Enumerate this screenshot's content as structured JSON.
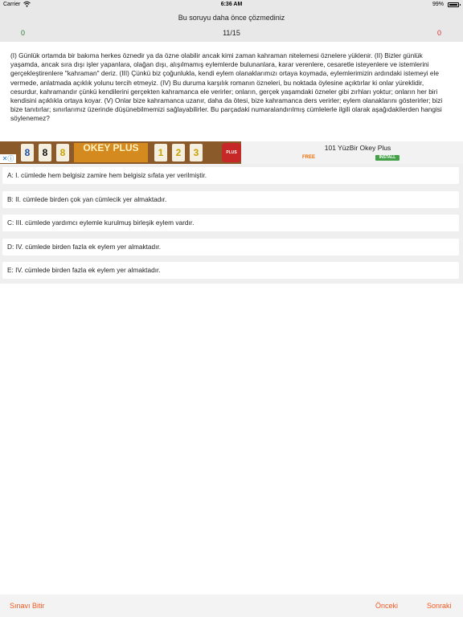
{
  "status_bar": {
    "carrier": "Carrier",
    "time": "6:36 AM",
    "battery": "99%"
  },
  "header": {
    "title": "Bu soruyu daha önce çözmediniz",
    "correct_count": "0",
    "progress": "11/15",
    "wrong_count": "0",
    "correct_color": "#2e7d32",
    "wrong_color": "#d32f2f"
  },
  "question": {
    "text": "(I) Günlük ortamda bir bakıma herkes öznedir ya da özne olabilir ancak kimi zaman kahraman nitelemesi öznelere yüklenir. (II) Bizler günlük yaşamda, ancak sıra dışı işler yapanlara, olağan dışı, alışılmamış eylemlerde bulunanlara, karar verenlere, cesaretle isteyenlere ve istemlerini gerçekleştirenlere \"kahraman\" deriz. (III) Çünkü biz çoğunlukla, kendi eylem olanaklarımızı ortaya koymada, eylemlerimizin ardındaki istemeyi ele vermede, anlatmada açıklık yolunu tercih etmeyiz. (IV) Bu duruma karşılık romanın özneleri, bu noktada öylesine açıktırlar ki onlar yüreklidir, cesurdur, kahramandır çünkü kendilerini gerçekten kahramanca ele verirler; onların, gerçek yaşamdaki özneler gibi zırhları yoktur; onların her biri kendisini açıklıkla ortaya koyar. (V) Onlar bize kahramanca uzanır, daha da ötesi, bize kahramanca ders verirler; eylem olanaklarını gösterirler; bizi bize tanıtırlar; sınırlarımız üzerinde düşünebilmemizi sağlayabilirler. Bu parçadaki numaralandırılmış cümlelerle ilgili olarak aşağıdakilerden hangisi söylenemez?"
  },
  "ad": {
    "tiles": [
      "8",
      "8",
      "8",
      "1",
      "2",
      "3"
    ],
    "logo_text": "OKEY PLUS",
    "close_label": "✕ⓘ",
    "icon_text": "PLUS",
    "app_name": "101 YüzBir Okey Plus",
    "free_label": "FREE",
    "install_label": "INSTALL"
  },
  "answers": [
    {
      "label": "A: I. cümlede hem belgisiz zamire hem belgisiz sıfata yer verilmiştir."
    },
    {
      "label": "B: II. cümlede birden çok yan cümlecik yer almaktadır."
    },
    {
      "label": "C: III. cümlede yardımcı eylemle kurulmuş birleşik eylem vardır."
    },
    {
      "label": "D: IV. cümlede birden fazla ek eylem yer almaktadır."
    },
    {
      "label": "E: IV. cümlede birden fazla ek eylem yer almaktadır."
    }
  ],
  "bottom_bar": {
    "finish_label": "Sınavı Bitir",
    "prev_label": "Önceki",
    "next_label": "Sonraki",
    "accent_color": "#ef5b25"
  }
}
